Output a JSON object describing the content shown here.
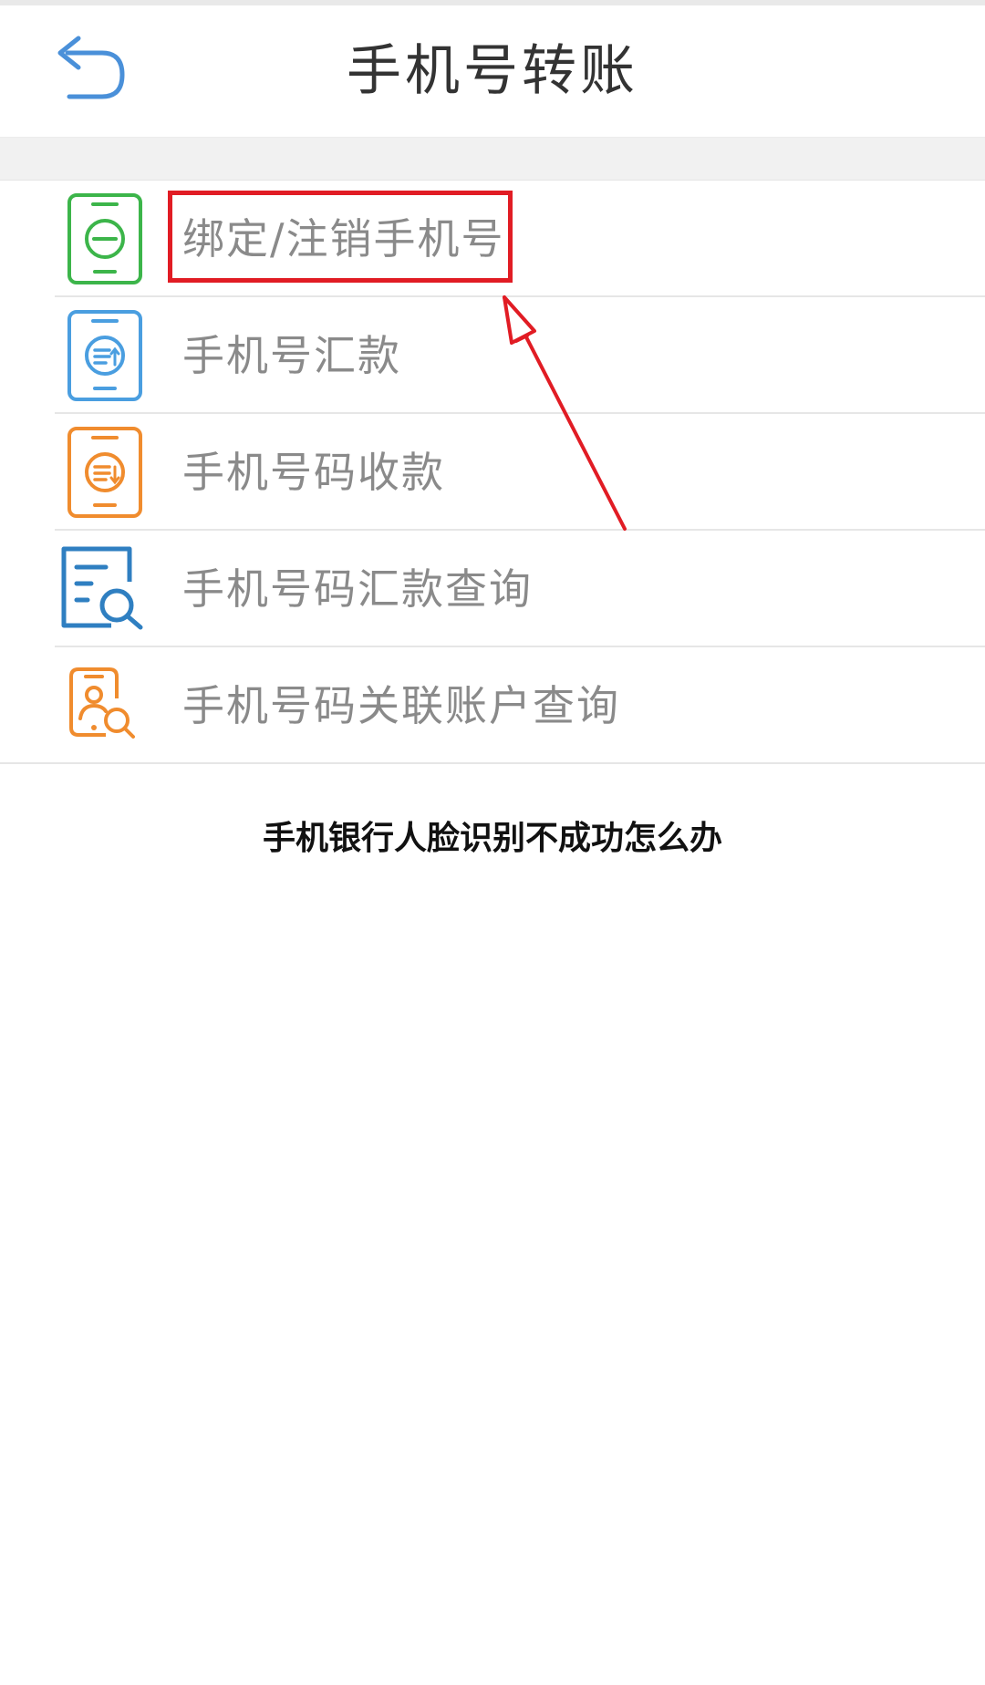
{
  "header": {
    "title": "手机号转账",
    "back_icon": "back-arrow-icon"
  },
  "menu": {
    "items": [
      {
        "label": "绑定/注销手机号",
        "icon": "phone-minus-icon",
        "color": "#3cb54a"
      },
      {
        "label": "手机号汇款",
        "icon": "phone-transfer-out-icon",
        "color": "#4a9ee0"
      },
      {
        "label": "手机号码收款",
        "icon": "phone-transfer-in-icon",
        "color": "#f08c2e"
      },
      {
        "label": "手机号码汇款查询",
        "icon": "document-search-icon",
        "color": "#2f7fc1"
      },
      {
        "label": "手机号码关联账户查询",
        "icon": "contact-search-icon",
        "color": "#f08c2e"
      }
    ]
  },
  "annotation": {
    "highlight_color": "#e11c24"
  },
  "caption": {
    "text": "手机银行人脸识别不成功怎么办"
  }
}
